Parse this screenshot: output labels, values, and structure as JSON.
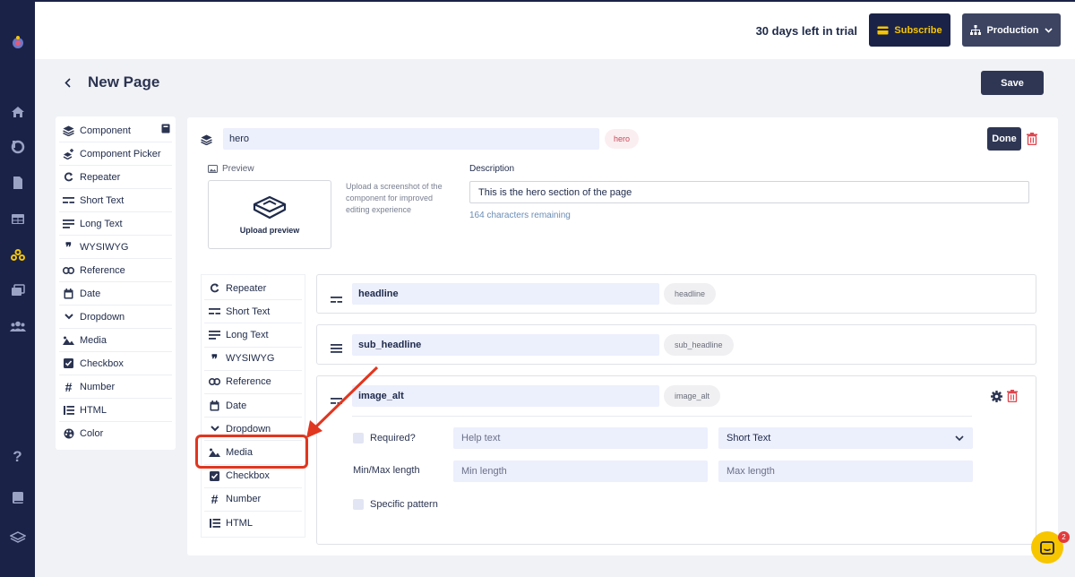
{
  "topbar": {
    "trial_text": "30 days left in trial",
    "subscribe_label": "Subscribe",
    "environment_label": "Production"
  },
  "page": {
    "title": "New Page",
    "save_label": "Save"
  },
  "palette": {
    "items": [
      {
        "label": "Component",
        "icon": "layers-icon"
      },
      {
        "label": "Component Picker",
        "icon": "layers-plus-icon"
      },
      {
        "label": "Repeater",
        "icon": "repeat-icon"
      },
      {
        "label": "Short Text",
        "icon": "short-text-icon"
      },
      {
        "label": "Long Text",
        "icon": "long-text-icon"
      },
      {
        "label": "WYSIWYG",
        "icon": "quote-icon"
      },
      {
        "label": "Reference",
        "icon": "link-icon"
      },
      {
        "label": "Date",
        "icon": "calendar-icon"
      },
      {
        "label": "Dropdown",
        "icon": "chevron-down-icon"
      },
      {
        "label": "Media",
        "icon": "image-icon"
      },
      {
        "label": "Checkbox",
        "icon": "checkbox-icon"
      },
      {
        "label": "Number",
        "icon": "hash-icon"
      },
      {
        "label": "HTML",
        "icon": "list-icon"
      },
      {
        "label": "Color",
        "icon": "palette-icon"
      }
    ]
  },
  "component": {
    "name": "hero",
    "badge": "hero",
    "done_label": "Done",
    "preview_label": "Preview",
    "upload_label": "Upload preview",
    "upload_help": "Upload a screenshot of the component for improved editing experience",
    "description_label": "Description",
    "description_value": "This is the hero section of the page",
    "chars_remaining": "164 characters remaining"
  },
  "field_types": {
    "items": [
      {
        "label": "Repeater"
      },
      {
        "label": "Short Text"
      },
      {
        "label": "Long Text"
      },
      {
        "label": "WYSIWYG"
      },
      {
        "label": "Reference"
      },
      {
        "label": "Date"
      },
      {
        "label": "Dropdown"
      },
      {
        "label": "Media"
      },
      {
        "label": "Checkbox"
      },
      {
        "label": "Number"
      },
      {
        "label": "HTML"
      }
    ]
  },
  "fields": [
    {
      "name": "headline",
      "badge": "headline"
    },
    {
      "name": "sub_headline",
      "badge": "sub_headline"
    },
    {
      "name": "image_alt",
      "badge": "image_alt"
    }
  ],
  "field_options": {
    "required_label": "Required?",
    "help_placeholder": "Help text",
    "type_value": "Short Text",
    "minmax_label": "Min/Max length",
    "min_placeholder": "Min length",
    "max_placeholder": "Max length",
    "pattern_label": "Specific pattern"
  },
  "chat": {
    "badge_count": "2"
  },
  "colors": {
    "sidebar": "#1a2247",
    "accent_yellow": "#f7c600",
    "highlight_red": "#e1361f",
    "primary_button": "#2e3654"
  }
}
